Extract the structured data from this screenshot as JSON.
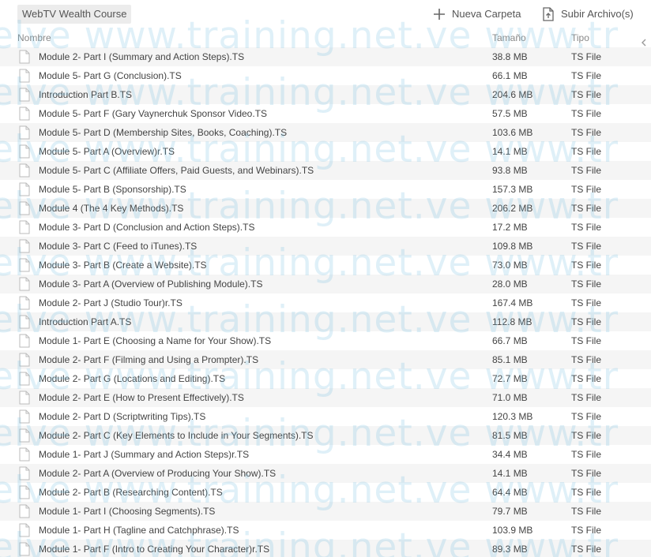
{
  "breadcrumb": {
    "current_folder": "WebTV Wealth Course"
  },
  "toolbar": {
    "new_folder_label": "Nueva Carpeta",
    "new_folder_icon": "plus-icon",
    "upload_label": "Subir Archivo(s)",
    "upload_icon": "upload-file-icon"
  },
  "columns": {
    "name": "Nombre",
    "size": "Tamaño",
    "type": "Tipo"
  },
  "files": [
    {
      "name": "Module 2- Part I (Summary and Action Steps).TS",
      "size": "38.8 MB",
      "type": "TS File"
    },
    {
      "name": "Module 5- Part G (Conclusion).TS",
      "size": "66.1 MB",
      "type": "TS File"
    },
    {
      "name": "Introduction Part B.TS",
      "size": "204.6 MB",
      "type": "TS File"
    },
    {
      "name": "Module 5- Part F (Gary Vaynerchuk Sponsor Video.TS",
      "size": "57.5 MB",
      "type": "TS File"
    },
    {
      "name": "Module 5- Part D (Membership Sites, Books, Coaching).TS",
      "size": "103.6 MB",
      "type": "TS File"
    },
    {
      "name": "Module 5- Part A (Overview)r.TS",
      "size": "14.1 MB",
      "type": "TS File"
    },
    {
      "name": "Module 5- Part C (Affiliate Offers, Paid Guests, and Webinars).TS",
      "size": "93.8 MB",
      "type": "TS File"
    },
    {
      "name": "Module 5- Part B (Sponsorship).TS",
      "size": "157.3 MB",
      "type": "TS File"
    },
    {
      "name": "Module 4 (The 4 Key Methods).TS",
      "size": "206.2 MB",
      "type": "TS File"
    },
    {
      "name": "Module 3- Part D (Conclusion and Action Steps).TS",
      "size": "17.2 MB",
      "type": "TS File"
    },
    {
      "name": "Module 3- Part C (Feed to iTunes).TS",
      "size": "109.8 MB",
      "type": "TS File"
    },
    {
      "name": "Module 3- Part B (Create a Website).TS",
      "size": "73.0 MB",
      "type": "TS File"
    },
    {
      "name": "Module 3- Part A (Overview of Publishing Module).TS",
      "size": "28.0 MB",
      "type": "TS File"
    },
    {
      "name": "Module 2- Part J (Studio Tour)r.TS",
      "size": "167.4 MB",
      "type": "TS File"
    },
    {
      "name": "Introduction Part A.TS",
      "size": "112.8 MB",
      "type": "TS File"
    },
    {
      "name": "Module 1- Part E (Choosing a Name for Your Show).TS",
      "size": "66.7 MB",
      "type": "TS File"
    },
    {
      "name": "Module 2- Part F (Filming and Using a Prompter).TS",
      "size": "85.1 MB",
      "type": "TS File"
    },
    {
      "name": "Module 2- Part G (Locations and Editing).TS",
      "size": "72.7 MB",
      "type": "TS File"
    },
    {
      "name": "Module 2- Part E (How to Present Effectively).TS",
      "size": "71.0 MB",
      "type": "TS File"
    },
    {
      "name": "Module 2- Part D (Scriptwriting Tips).TS",
      "size": "120.3 MB",
      "type": "TS File"
    },
    {
      "name": "Module 2- Part C (Key Elements to Include in Your Segments).TS",
      "size": "81.5 MB",
      "type": "TS File"
    },
    {
      "name": "Module 1- Part J (Summary and Action Steps)r.TS",
      "size": "34.4 MB",
      "type": "TS File"
    },
    {
      "name": "Module 2- Part A (Overview of Producing Your Show).TS",
      "size": "14.1 MB",
      "type": "TS File"
    },
    {
      "name": "Module 2- Part B (Researching Content).TS",
      "size": "64.4 MB",
      "type": "TS File"
    },
    {
      "name": "Module 1- Part I (Choosing Segments).TS",
      "size": "79.7 MB",
      "type": "TS File"
    },
    {
      "name": "Module 1- Part H (Tagline and Catchphrase).TS",
      "size": "103.9 MB",
      "type": "TS File"
    },
    {
      "name": "Module 1- Part F (Intro to Creating Your Character)r.TS",
      "size": "89.3 MB",
      "type": "TS File"
    }
  ],
  "watermark": {
    "text": "elve www.training.net.ve www.tr"
  }
}
